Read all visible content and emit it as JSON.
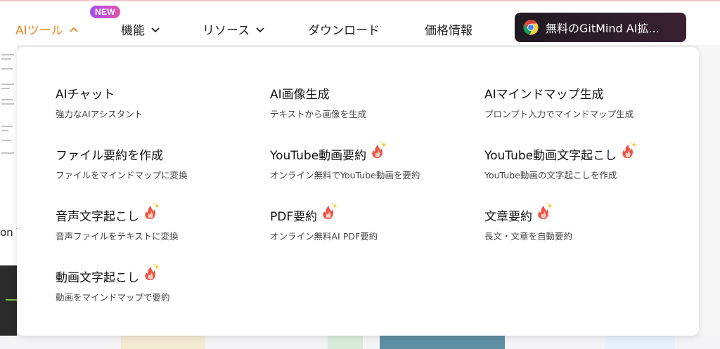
{
  "nav": {
    "items": [
      {
        "label": "AIツール"
      },
      {
        "label": "機能"
      },
      {
        "label": "リソース"
      },
      {
        "label": "ダウンロード"
      },
      {
        "label": "価格情報"
      }
    ],
    "badge": "NEW",
    "extension_button": "無料のGitMind AI拡..."
  },
  "background": {
    "left_text": "on T"
  },
  "menu": {
    "items": [
      {
        "title": "AIチャット",
        "desc": "強力なAIアシスタント",
        "hot": false
      },
      {
        "title": "AI画像生成",
        "desc": "テキストから画像を生成",
        "hot": false
      },
      {
        "title": "AIマインドマップ生成",
        "desc": "プロンプト入力でマインドマップ生成",
        "hot": false
      },
      {
        "title": "ファイル要約を作成",
        "desc": "ファイルをマインドマップに変換",
        "hot": false
      },
      {
        "title": "YouTube動画要約",
        "desc": "オンライン無料でYouTube動画を要約",
        "hot": true
      },
      {
        "title": "YouTube動画文字起こし",
        "desc": "YouTube動画の文字起こしを作成",
        "hot": true
      },
      {
        "title": "音声文字起こし",
        "desc": "音声ファイルをテキストに変換",
        "hot": true
      },
      {
        "title": "PDF要約",
        "desc": "オンライン無料AI PDF要約",
        "hot": true
      },
      {
        "title": "文章要約",
        "desc": "長文・文章を自動要約",
        "hot": true
      },
      {
        "title": "動画文字起こし",
        "desc": "動画をマインドマップで要約",
        "hot": true
      }
    ]
  },
  "colors": {
    "accent": "#f0831e",
    "badge_start": "#a34fe8",
    "badge_end": "#e64fb0",
    "extension_bg": "#1f1a22"
  }
}
